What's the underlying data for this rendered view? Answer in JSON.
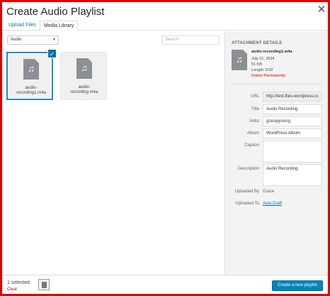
{
  "modal": {
    "title": "Create Audio Playlist",
    "close_icon": "close-icon"
  },
  "tabs": [
    {
      "label": "Upload Files"
    },
    {
      "label": "Media Library"
    }
  ],
  "toolbar": {
    "filter_value": "Audio",
    "search_placeholder": "Search"
  },
  "attachments": [
    {
      "name": "audio-recording1.m4a",
      "name_line1": "audio-",
      "name_line2": "recording1.m4a",
      "selected": true,
      "icon": "audio-file-icon"
    },
    {
      "name": "audio-recording.m4a",
      "name_line1": "audio-",
      "name_line2": "recording.m4a",
      "selected": false,
      "icon": "audio-file-icon"
    }
  ],
  "details": {
    "heading": "ATTACHMENT DETAILS",
    "filename": "audio-recording1.m4a",
    "date": "July 21, 2014",
    "size": "51 KB",
    "length": "Length: 0:02",
    "delete_label": "Delete Permanently",
    "fields": {
      "url_label": "URL",
      "url_value": "http://test.files.wordpress.cc",
      "title_label": "Title",
      "title_value": "Audio Recording",
      "artist_label": "Artist",
      "artist_value": "gracejiyoung",
      "album_label": "Album",
      "album_value": "WordPress Album",
      "caption_label": "Caption",
      "caption_value": "",
      "description_label": "Description",
      "description_value": "Audio Recording",
      "uploaded_by_label": "Uploaded By",
      "uploaded_by_value": "Grace",
      "uploaded_to_label": "Uploaded To",
      "uploaded_to_value": "Auto Draft"
    }
  },
  "footer": {
    "selected_count": "1 selected",
    "clear_label": "Clear",
    "primary_button": "Create a new playlist"
  },
  "colors": {
    "accent": "#0073aa",
    "primary_button": "#0085ba",
    "danger": "#dd0000",
    "frame_border": "#e00000"
  }
}
